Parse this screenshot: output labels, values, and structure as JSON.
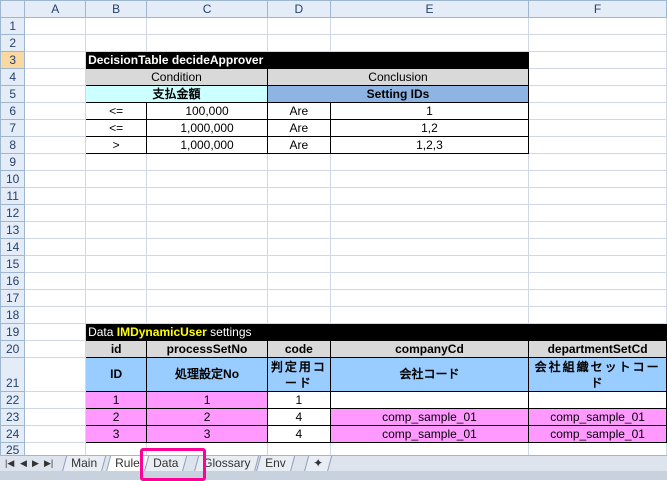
{
  "columns": [
    "A",
    "B",
    "C",
    "D",
    "E",
    "F"
  ],
  "decision_table": {
    "title": "DecisionTable decideApprover",
    "condition_label": "Condition",
    "conclusion_label": "Conclusion",
    "condition_field": "支払金額",
    "conclusion_field": "Setting IDs",
    "rows": [
      {
        "op": "<=",
        "value": "100,000",
        "verb": "Are",
        "ids": "1"
      },
      {
        "op": "<=",
        "value": "1,000,000",
        "verb": "Are",
        "ids": "1,2"
      },
      {
        "op": ">",
        "value": "1,000,000",
        "verb": "Are",
        "ids": "1,2,3"
      }
    ]
  },
  "data_table": {
    "title_prefix": "Data ",
    "title_name": "IMDynamicUser",
    "title_suffix": " settings",
    "headers": [
      "id",
      "processSetNo",
      "code",
      "companyCd",
      "departmentSetCd"
    ],
    "labels": [
      "ID",
      "処理設定No",
      "判定用コード",
      "会社コード",
      "会社組織セットコード"
    ],
    "rows": [
      [
        "1",
        "1",
        "1",
        "",
        ""
      ],
      [
        "2",
        "2",
        "4",
        "comp_sample_01",
        "comp_sample_01"
      ],
      [
        "3",
        "3",
        "4",
        "comp_sample_01",
        "comp_sample_01"
      ]
    ]
  },
  "sheet_tabs": [
    "Main",
    "Rule",
    "Data",
    "Glossary",
    "Env"
  ],
  "active_tab": "Rule",
  "highlighted_tab": "Data",
  "selected_row": 3,
  "colors": {
    "pink": "#ff99ff",
    "highlight": "#ff0099",
    "header_blue": "#99ccff"
  }
}
